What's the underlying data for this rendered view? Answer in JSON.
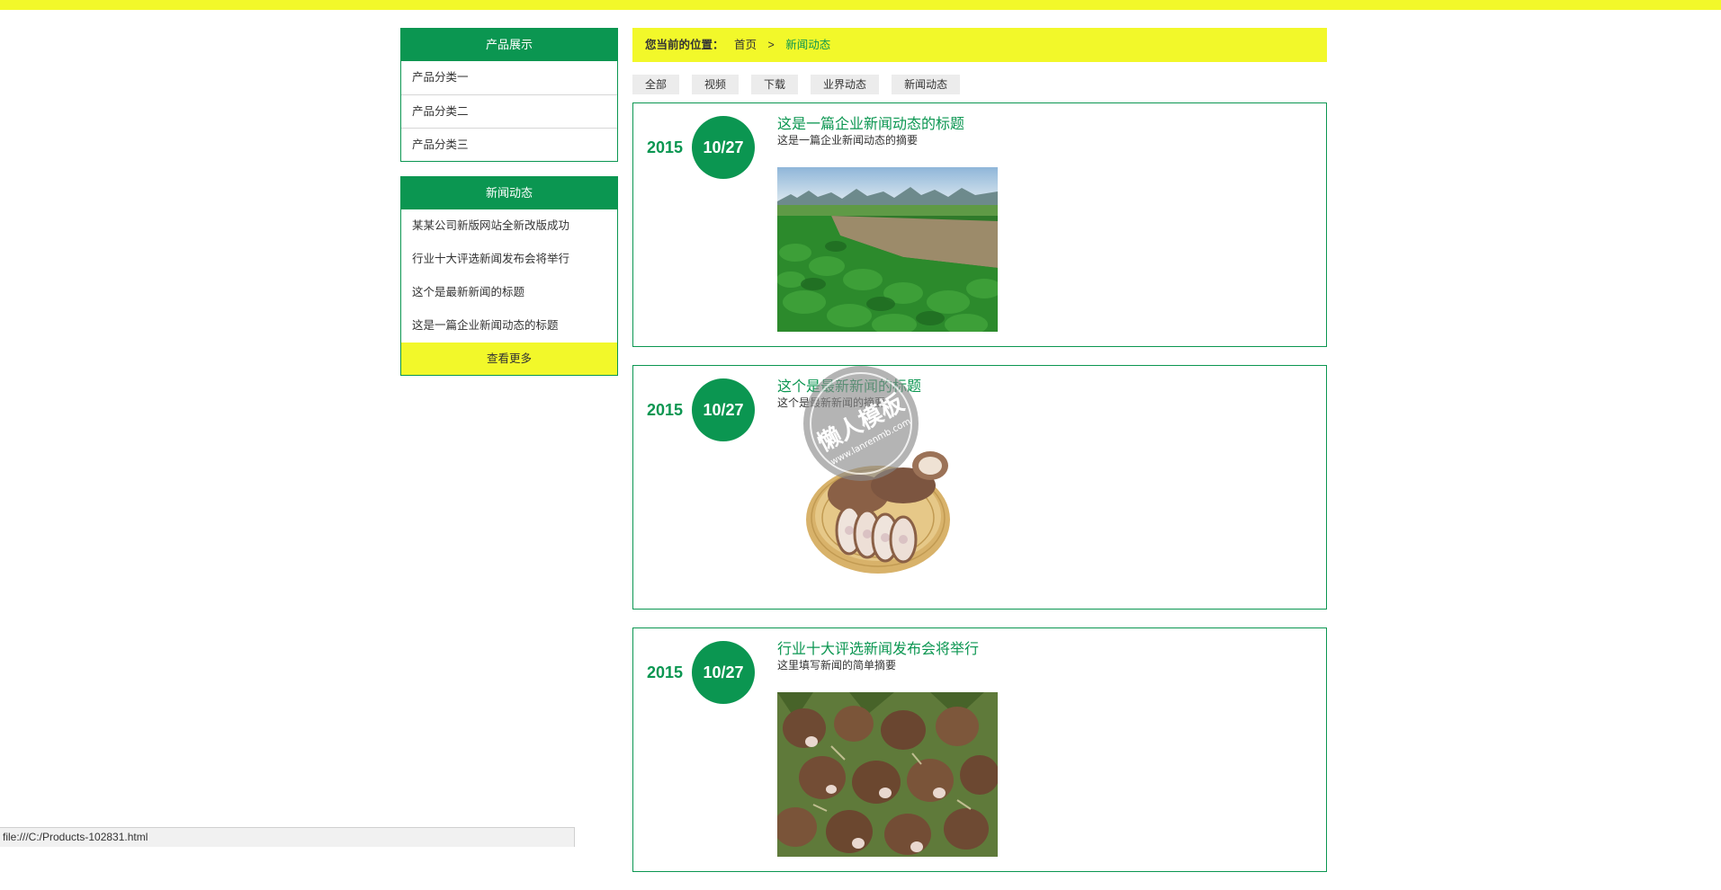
{
  "sidebar": {
    "products": {
      "title": "产品展示",
      "items": [
        "产品分类一",
        "产品分类二",
        "产品分类三"
      ]
    },
    "news": {
      "title": "新闻动态",
      "items": [
        "某某公司新版网站全新改版成功",
        "行业十大评选新闻发布会将举行",
        "这个是最新新闻的标题",
        "这是一篇企业新闻动态的标题"
      ],
      "more_label": "查看更多"
    }
  },
  "breadcrumb": {
    "label": "您当前的位置：",
    "home": "首页",
    "separator": ">",
    "current": "新闻动态"
  },
  "tabs": [
    "全部",
    "视频",
    "下载",
    "业界动态",
    "新闻动态"
  ],
  "articles": [
    {
      "year": "2015",
      "date": "10/27",
      "title": "这是一篇企业新闻动态的标题",
      "summary": "这是一篇企业新闻动态的摘要",
      "image": "taro-field-photo"
    },
    {
      "year": "2015",
      "date": "10/27",
      "title": "这个是最新新闻的标题",
      "summary": "这个是最新新闻的摘要",
      "image": "sliced-taro-basket-photo"
    },
    {
      "year": "2015",
      "date": "10/27",
      "title": "行业十大评选新闻发布会将举行",
      "summary": "这里填写新闻的简单摘要",
      "image": "taro-pile-photo"
    }
  ],
  "watermark": {
    "line1": "懒人模板",
    "line2": "www.lanrenmb.com"
  },
  "status_bar": {
    "url": "file:///C:/Products-102831.html"
  },
  "colors": {
    "accent_green": "#0b9651",
    "accent_yellow": "#f2f82a"
  }
}
